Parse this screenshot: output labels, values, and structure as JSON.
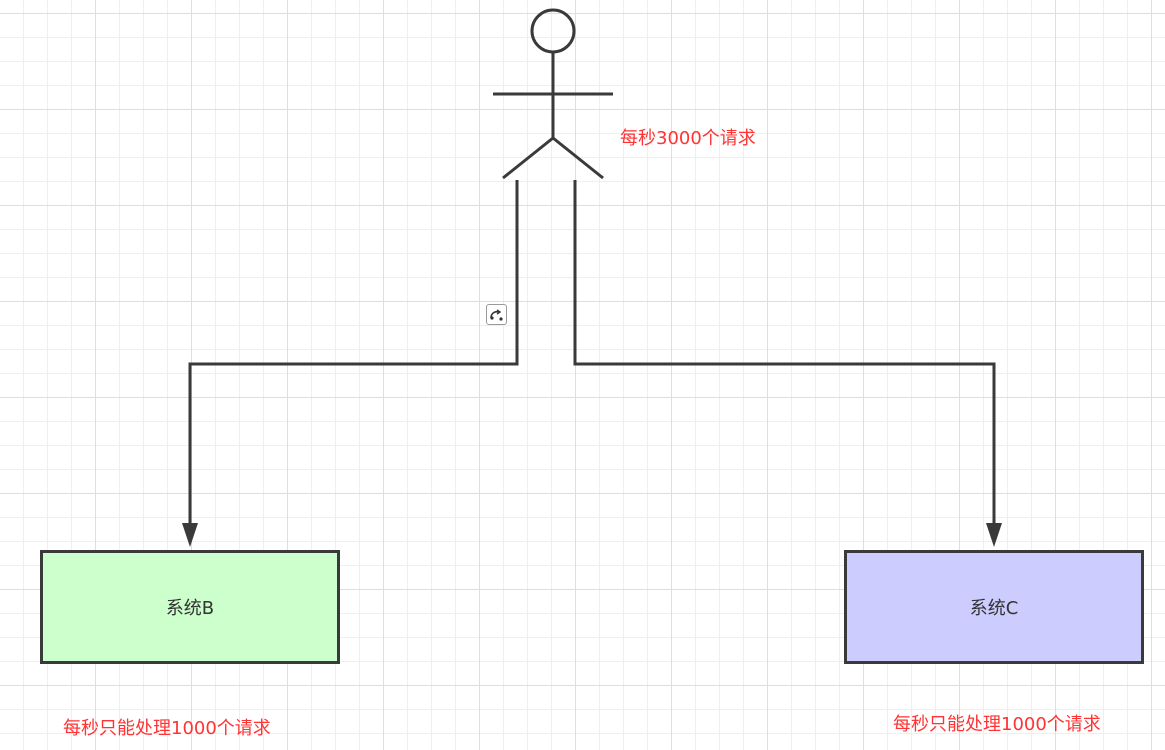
{
  "actor": {
    "note": "每秒3000个请求"
  },
  "systems": [
    {
      "label": "系统B",
      "note": "每秒只能处理1000个请求",
      "fill": "#ccffcc"
    },
    {
      "label": "系统C",
      "note": "每秒只能处理1000个请求",
      "fill": "#ccccff"
    }
  ],
  "colors": {
    "note_text": "#ff3333",
    "stroke": "#3a3a3a"
  },
  "icons": {
    "connector_marker": "link-icon"
  }
}
